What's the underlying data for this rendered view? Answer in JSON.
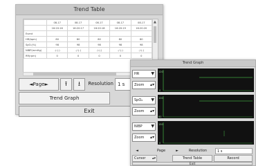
{
  "trend_table": {
    "title": "Trend Table",
    "column_dates": [
      "08-17",
      "08-17",
      "08-17",
      "08-17",
      "08-17"
    ],
    "column_times": [
      "16:20:16",
      "16:20:17",
      "16:20:18",
      "16:20:19",
      "16:20:20"
    ],
    "rows": [
      {
        "label": "Event",
        "values": [
          "",
          "",
          "",
          "",
          ""
        ]
      },
      {
        "label": "HR(bpm)",
        "values": [
          "80",
          "80",
          "80",
          "80",
          "80"
        ]
      },
      {
        "label": "SpO₂(%)",
        "values": [
          "98",
          "98",
          "98",
          "98",
          "98"
        ]
      },
      {
        "label": "NIBP(mmHg)",
        "values": [
          "-/-(-)",
          "-/-(-)",
          "-/-(-)",
          "-/-(-)",
          "-/-(-)"
        ]
      },
      {
        "label": "RR(rpm)",
        "values": [
          "0",
          "0",
          "0",
          "0",
          "0"
        ]
      }
    ],
    "page_label": "Page",
    "page_left_icon": "◄",
    "page_right_icon": "►",
    "page_up_icon": "⭱",
    "page_down_icon": "⭳",
    "resolution_label": "Resolution",
    "resolution_value": "1 s",
    "dropdown_icon": "▼",
    "trend_graph_button": "Trend Graph",
    "exit_button": "Exit"
  },
  "trend_graph": {
    "title": "Trend Graph",
    "dropdown_icon": "▼",
    "stepper_icon": "▴▾",
    "rows": [
      {
        "param": "HR",
        "zoom": "Zoom",
        "scale_top": "120",
        "scale_bottom": "0"
      },
      {
        "param": "SpO₂",
        "zoom": "Zoom",
        "scale_top": "100",
        "scale_bottom": "80"
      },
      {
        "param": "NIBP",
        "zoom": "Zoom",
        "scale_top": "150",
        "scale_bottom": "0"
      }
    ],
    "page_left_icon": "◄",
    "page_right_icon": "►",
    "page_label": "Page",
    "resolution_label": "Resolution",
    "resolution_value": "1 s",
    "cursor_label": "Cursor",
    "trend_table_button": "Trend Table",
    "record_button": "Record",
    "exit_button": "Exit"
  },
  "colors": {
    "plot_bg": "#111111",
    "plot_line": "#3fa33f",
    "scale_text": "#9bd49b"
  }
}
